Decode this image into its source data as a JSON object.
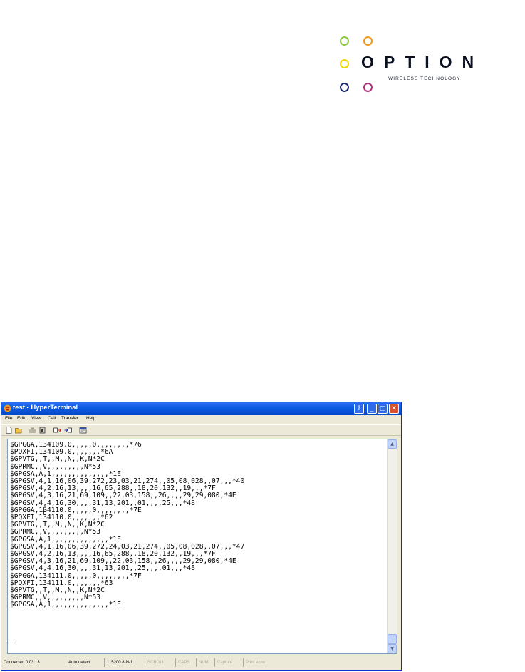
{
  "logo": {
    "brand": "OPTION",
    "tagline": "WIRELESS TECHNOLOGY",
    "ring_colors": [
      "#8dc63f",
      "#f7941d",
      "#f2d400",
      "#1b2a7a",
      "#b0307a"
    ]
  },
  "window": {
    "title": "test - HyperTerminal",
    "icons": [
      "phone-icon",
      "help-icon",
      "minimize-icon",
      "maximize-icon",
      "close-icon"
    ],
    "menu": [
      "File",
      "Edit",
      "View",
      "Call",
      "Transfer",
      "Help"
    ],
    "toolbar": [
      "new-icon",
      "open-icon",
      "call-icon",
      "disconnect-icon",
      "send-icon",
      "receive-icon",
      "properties-icon"
    ]
  },
  "terminal": {
    "lines": [
      "$GPGGA,134109.0,,,,,0,,,,,,,,*76",
      "$PQXFI,134109.0,,,,,,,*6A",
      "$GPVTG,,T,,M,,N,,K,N*2C",
      "$GPRMC,,V,,,,,,,,,N*53",
      "$GPGSA,A,1,,,,,,,,,,,,,,*1E",
      "$GPGSV,4,1,16,06,39,272,23,03,21,274,,05,08,028,,07,,,*40",
      "$GPGSV,4,2,16,13,,,,16,65,288,,18,20,132,,19,,,*7F",
      "$GPGSV,4,3,16,21,69,109,,22,03,158,,26,,,,29,29,080,*4E",
      "$GPGSV,4,4,16,30,,,,31,13,201,,01,,,,25,,,*48",
      "$GPGGA,1β4110.0,,,,,0,,,,,,,,*7E",
      "$PQXFI,134110.0,,,,,,,*62",
      "$GPVTG,,T,,M,,N,,K,N*2C",
      "$GPRMC,,V,,,,,,,,,N*53",
      "$GPGSA,A,1,,,,,,,,,,,,,,*1E",
      "$GPGSV,4,1,16,06,39,272,24,03,21,274,,05,08,028,,07,,,*47",
      "$GPGSV,4,2,16,13,,,,16,65,288,,18,20,132,,19,,,*7F",
      "$GPGSV,4,3,16,21,69,109,,22,03,158,,26,,,,29,29,080,*4E",
      "$GPGSV,4,4,16,30,,,,31,13,201,,25,,,,01,,,*48",
      "$GPGGA,134111.0,,,,,0,,,,,,,,*7F",
      "$PQXFI,134111.0,,,,,,,*63",
      "$GPVTG,,T,,M,,N,,K,N*2C",
      "$GPRMC,,V,,,,,,,,,N*53",
      "$GPGSA,A,1,,,,,,,,,,,,,,*1E"
    ]
  },
  "status": {
    "connected": "Connected 0:03:13",
    "detect": "Auto detect",
    "settings": "115200 8-N-1",
    "scroll": "SCROLL",
    "caps": "CAPS",
    "num": "NUM",
    "capture": "Capture",
    "print_echo": "Print echo"
  }
}
